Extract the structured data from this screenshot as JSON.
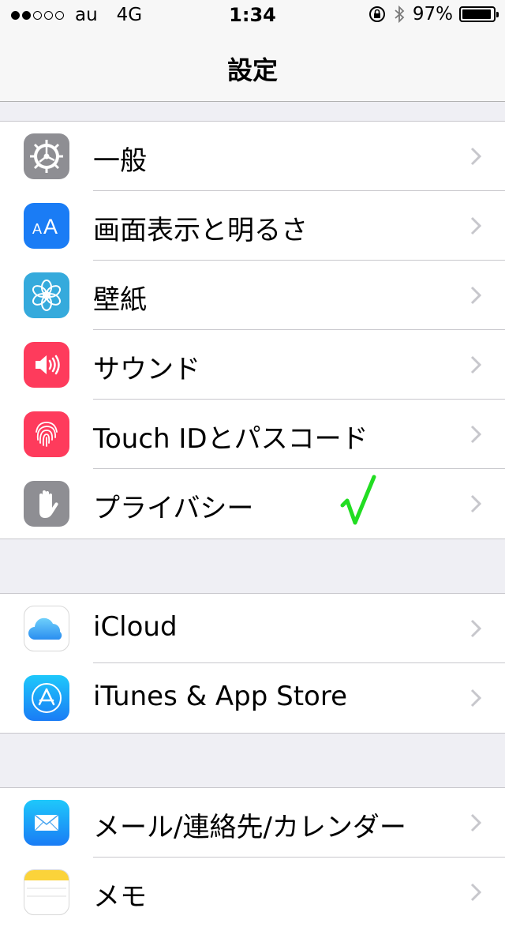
{
  "status_bar": {
    "carrier": "au",
    "network": "4G",
    "time": "1:34",
    "battery_percent": "97%",
    "signal_bars_filled": 2,
    "signal_bars_total": 5
  },
  "nav": {
    "title": "設定"
  },
  "groups": [
    {
      "items": [
        {
          "label": "一般",
          "icon": "gear-icon",
          "color": "#8e8e93"
        },
        {
          "label": "画面表示と明るさ",
          "icon": "text-size-icon",
          "color": "#1a7cf5"
        },
        {
          "label": "壁紙",
          "icon": "flower-icon",
          "color": "#35aadc"
        },
        {
          "label": "サウンド",
          "icon": "speaker-icon",
          "color": "#fe3b5c"
        },
        {
          "label": "Touch IDとパスコード",
          "icon": "fingerprint-icon",
          "color": "#fe3b5c"
        },
        {
          "label": "プライバシー",
          "icon": "hand-icon",
          "color": "#8e8e93"
        }
      ]
    },
    {
      "items": [
        {
          "label": "iCloud",
          "icon": "cloud-icon",
          "color": "#ffffff"
        },
        {
          "label": "iTunes & App Store",
          "icon": "app-store-icon",
          "color": "#1a8cf5"
        }
      ]
    },
    {
      "items": [
        {
          "label": "メール/連絡先/カレンダー",
          "icon": "mail-icon",
          "color": "#1a8cf5"
        },
        {
          "label": "メモ",
          "icon": "notes-icon",
          "color": "#ffffff"
        }
      ]
    }
  ],
  "annotation": {
    "icon": "green-checkmark-icon",
    "color": "#22dd22"
  }
}
